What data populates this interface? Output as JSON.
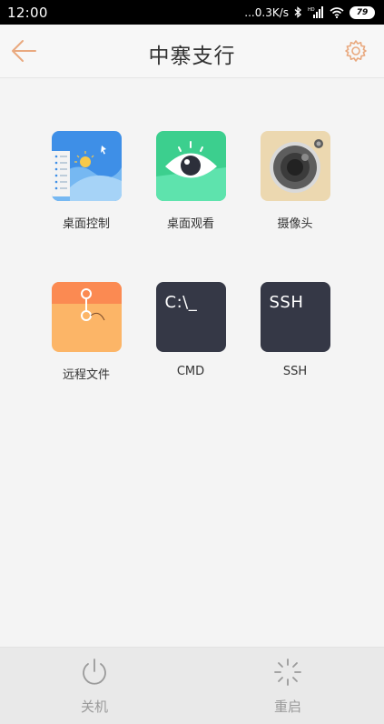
{
  "status_bar": {
    "time": "12:00",
    "speed": "...0.3K/s",
    "battery": "79"
  },
  "header": {
    "title": "中寨支行",
    "back_icon": "arrow-left-icon",
    "settings_icon": "gear-icon",
    "accent_color": "#e9a97f"
  },
  "apps": [
    {
      "label": "桌面控制",
      "icon": "desktop-control-icon"
    },
    {
      "label": "桌面观看",
      "icon": "eye-icon"
    },
    {
      "label": "摄像头",
      "icon": "camera-icon"
    },
    {
      "label": "远程文件",
      "icon": "folder-icon"
    },
    {
      "label": "CMD",
      "icon": "terminal-icon",
      "glyph": "C:\\_"
    },
    {
      "label": "SSH",
      "icon": "terminal-icon",
      "glyph": "SSH"
    }
  ],
  "bottom_bar": {
    "shutdown_label": "关机",
    "shutdown_icon": "power-icon",
    "restart_label": "重启",
    "restart_icon": "loading-spinner-icon"
  }
}
